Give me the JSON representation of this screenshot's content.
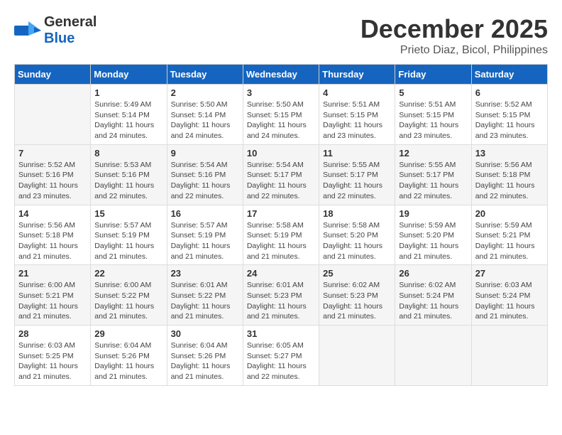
{
  "header": {
    "logo_line1": "General",
    "logo_line2": "Blue",
    "month": "December 2025",
    "location": "Prieto Diaz, Bicol, Philippines"
  },
  "weekdays": [
    "Sunday",
    "Monday",
    "Tuesday",
    "Wednesday",
    "Thursday",
    "Friday",
    "Saturday"
  ],
  "weeks": [
    [
      {
        "day": "",
        "info": ""
      },
      {
        "day": "1",
        "info": "Sunrise: 5:49 AM\nSunset: 5:14 PM\nDaylight: 11 hours\nand 24 minutes."
      },
      {
        "day": "2",
        "info": "Sunrise: 5:50 AM\nSunset: 5:14 PM\nDaylight: 11 hours\nand 24 minutes."
      },
      {
        "day": "3",
        "info": "Sunrise: 5:50 AM\nSunset: 5:15 PM\nDaylight: 11 hours\nand 24 minutes."
      },
      {
        "day": "4",
        "info": "Sunrise: 5:51 AM\nSunset: 5:15 PM\nDaylight: 11 hours\nand 23 minutes."
      },
      {
        "day": "5",
        "info": "Sunrise: 5:51 AM\nSunset: 5:15 PM\nDaylight: 11 hours\nand 23 minutes."
      },
      {
        "day": "6",
        "info": "Sunrise: 5:52 AM\nSunset: 5:15 PM\nDaylight: 11 hours\nand 23 minutes."
      }
    ],
    [
      {
        "day": "7",
        "info": "Sunrise: 5:52 AM\nSunset: 5:16 PM\nDaylight: 11 hours\nand 23 minutes."
      },
      {
        "day": "8",
        "info": "Sunrise: 5:53 AM\nSunset: 5:16 PM\nDaylight: 11 hours\nand 22 minutes."
      },
      {
        "day": "9",
        "info": "Sunrise: 5:54 AM\nSunset: 5:16 PM\nDaylight: 11 hours\nand 22 minutes."
      },
      {
        "day": "10",
        "info": "Sunrise: 5:54 AM\nSunset: 5:17 PM\nDaylight: 11 hours\nand 22 minutes."
      },
      {
        "day": "11",
        "info": "Sunrise: 5:55 AM\nSunset: 5:17 PM\nDaylight: 11 hours\nand 22 minutes."
      },
      {
        "day": "12",
        "info": "Sunrise: 5:55 AM\nSunset: 5:17 PM\nDaylight: 11 hours\nand 22 minutes."
      },
      {
        "day": "13",
        "info": "Sunrise: 5:56 AM\nSunset: 5:18 PM\nDaylight: 11 hours\nand 22 minutes."
      }
    ],
    [
      {
        "day": "14",
        "info": "Sunrise: 5:56 AM\nSunset: 5:18 PM\nDaylight: 11 hours\nand 21 minutes."
      },
      {
        "day": "15",
        "info": "Sunrise: 5:57 AM\nSunset: 5:19 PM\nDaylight: 11 hours\nand 21 minutes."
      },
      {
        "day": "16",
        "info": "Sunrise: 5:57 AM\nSunset: 5:19 PM\nDaylight: 11 hours\nand 21 minutes."
      },
      {
        "day": "17",
        "info": "Sunrise: 5:58 AM\nSunset: 5:19 PM\nDaylight: 11 hours\nand 21 minutes."
      },
      {
        "day": "18",
        "info": "Sunrise: 5:58 AM\nSunset: 5:20 PM\nDaylight: 11 hours\nand 21 minutes."
      },
      {
        "day": "19",
        "info": "Sunrise: 5:59 AM\nSunset: 5:20 PM\nDaylight: 11 hours\nand 21 minutes."
      },
      {
        "day": "20",
        "info": "Sunrise: 5:59 AM\nSunset: 5:21 PM\nDaylight: 11 hours\nand 21 minutes."
      }
    ],
    [
      {
        "day": "21",
        "info": "Sunrise: 6:00 AM\nSunset: 5:21 PM\nDaylight: 11 hours\nand 21 minutes."
      },
      {
        "day": "22",
        "info": "Sunrise: 6:00 AM\nSunset: 5:22 PM\nDaylight: 11 hours\nand 21 minutes."
      },
      {
        "day": "23",
        "info": "Sunrise: 6:01 AM\nSunset: 5:22 PM\nDaylight: 11 hours\nand 21 minutes."
      },
      {
        "day": "24",
        "info": "Sunrise: 6:01 AM\nSunset: 5:23 PM\nDaylight: 11 hours\nand 21 minutes."
      },
      {
        "day": "25",
        "info": "Sunrise: 6:02 AM\nSunset: 5:23 PM\nDaylight: 11 hours\nand 21 minutes."
      },
      {
        "day": "26",
        "info": "Sunrise: 6:02 AM\nSunset: 5:24 PM\nDaylight: 11 hours\nand 21 minutes."
      },
      {
        "day": "27",
        "info": "Sunrise: 6:03 AM\nSunset: 5:24 PM\nDaylight: 11 hours\nand 21 minutes."
      }
    ],
    [
      {
        "day": "28",
        "info": "Sunrise: 6:03 AM\nSunset: 5:25 PM\nDaylight: 11 hours\nand 21 minutes."
      },
      {
        "day": "29",
        "info": "Sunrise: 6:04 AM\nSunset: 5:26 PM\nDaylight: 11 hours\nand 21 minutes."
      },
      {
        "day": "30",
        "info": "Sunrise: 6:04 AM\nSunset: 5:26 PM\nDaylight: 11 hours\nand 21 minutes."
      },
      {
        "day": "31",
        "info": "Sunrise: 6:05 AM\nSunset: 5:27 PM\nDaylight: 11 hours\nand 22 minutes."
      },
      {
        "day": "",
        "info": ""
      },
      {
        "day": "",
        "info": ""
      },
      {
        "day": "",
        "info": ""
      }
    ]
  ]
}
